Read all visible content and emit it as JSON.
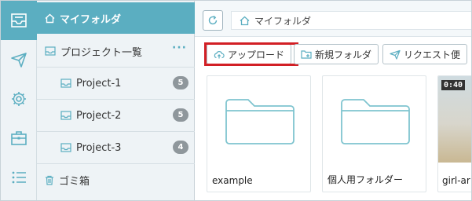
{
  "sidebar": {
    "my_folder": "マイフォルダ",
    "project_list": "プロジェクト一覧",
    "more": "···",
    "projects": [
      {
        "label": "Project-1",
        "count": "5"
      },
      {
        "label": "Project-2",
        "count": "5"
      },
      {
        "label": "Project-3",
        "count": "4"
      }
    ],
    "trash": "ゴミ箱"
  },
  "rail": {
    "items": [
      "inbox-icon",
      "send-icon",
      "settings-icon",
      "briefcase-icon",
      "list-icon"
    ],
    "active": "inbox-icon"
  },
  "breadcrumb": {
    "label": "マイフォルダ"
  },
  "toolbar": {
    "upload": "アップロード",
    "new_folder": "新規フォルダ",
    "request": "リクエスト便"
  },
  "files": [
    {
      "name": "example",
      "type": "folder"
    },
    {
      "name": "個人用フォルダー",
      "type": "folder"
    },
    {
      "name": "girl-ar",
      "type": "video",
      "duration": "0:40"
    }
  ],
  "colors": {
    "accent": "#5baec1",
    "highlight": "#d21f25",
    "badge": "#8f979c",
    "folder_stroke": "#7fc4cf"
  }
}
